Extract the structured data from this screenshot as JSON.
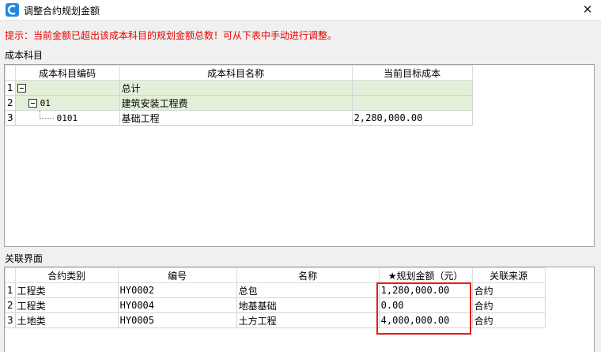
{
  "window": {
    "title": "调整合约规划金额",
    "close_glyph": "✕"
  },
  "hint": "提示：当前金额已超出该成本科目的规划金额总数！可从下表中手动进行调整。",
  "cost_section": {
    "label": "成本科目",
    "columns": [
      "成本科目编码",
      "成本科目名称",
      "当前目标成本"
    ],
    "rows": [
      {
        "num": "1",
        "code": "",
        "name": "总计",
        "cost": ""
      },
      {
        "num": "2",
        "code": "01",
        "name": "建筑安装工程费",
        "cost": ""
      },
      {
        "num": "3",
        "code": "0101",
        "name": "基础工程",
        "cost": "2,280,000.00"
      }
    ]
  },
  "link_section": {
    "label": "关联界面",
    "columns": [
      "合约类别",
      "编号",
      "名称",
      "★规划金额（元）",
      "关联来源"
    ],
    "rows": [
      {
        "num": "1",
        "category": "工程类",
        "code": "HY0002",
        "name": "总包",
        "amount": "1,280,000.00",
        "source": "合约"
      },
      {
        "num": "2",
        "category": "工程类",
        "code": "HY0004",
        "name": "地基基础",
        "amount": "0.00",
        "source": "合约"
      },
      {
        "num": "3",
        "category": "土地类",
        "code": "HY0005",
        "name": "土方工程",
        "amount": "4,000,000.00",
        "source": "合约"
      }
    ]
  },
  "colors": {
    "hint": "#e60000",
    "summary_row": "#e2f0d9",
    "highlight": "#e0201c",
    "icon": "#1e88e5"
  }
}
